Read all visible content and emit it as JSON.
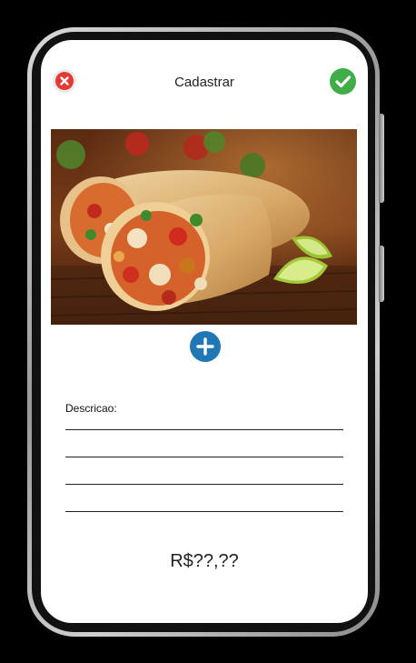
{
  "header": {
    "title": "Cadastrar",
    "cancel_icon": "close-icon",
    "confirm_icon": "check-icon"
  },
  "photo": {
    "subject": "food-photo",
    "add_icon": "plus-icon"
  },
  "form": {
    "description_label": "Descricao:",
    "description_value": "",
    "price": "R$??,??"
  },
  "colors": {
    "cancel": "#e53935",
    "confirm": "#3fae49",
    "add": "#1f78b4"
  }
}
